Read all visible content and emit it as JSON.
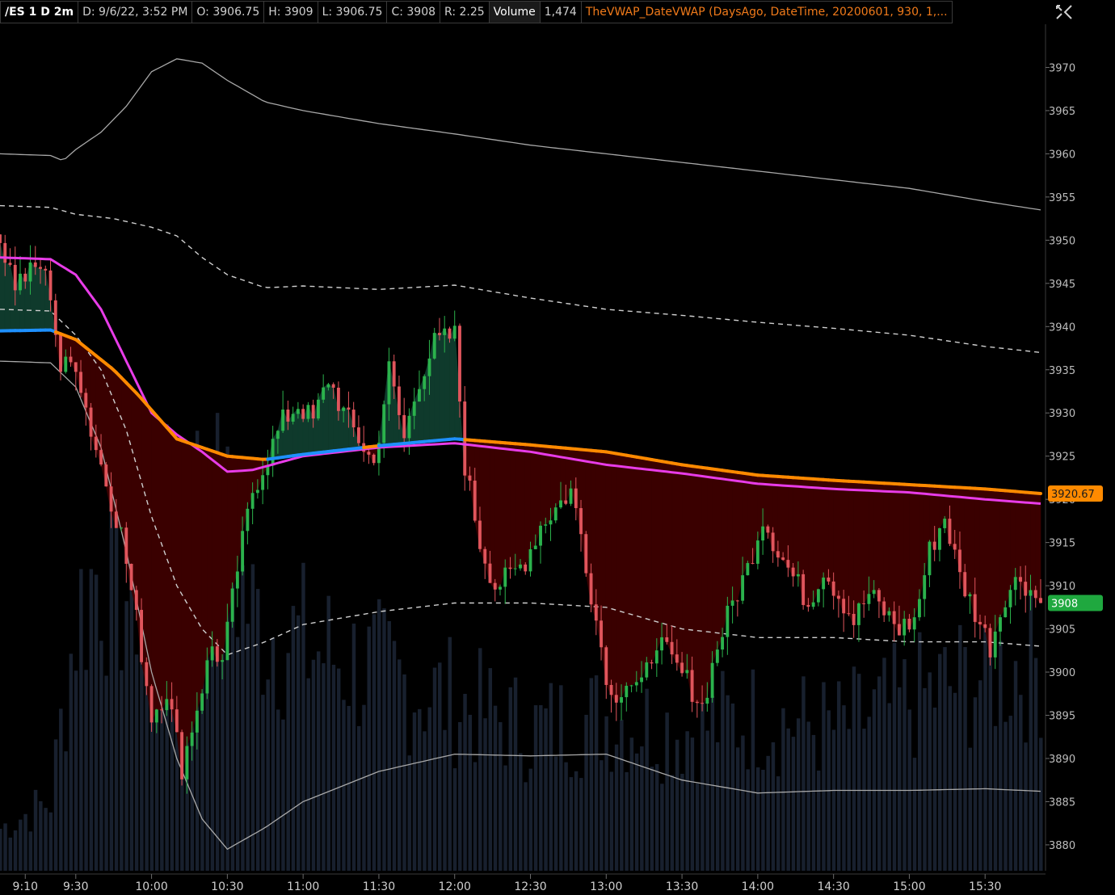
{
  "header": {
    "symbol": "/ES 1 D 2m",
    "date": "D: 9/6/22, 3:52 PM",
    "open": "O: 3906.75",
    "high": "H: 3909",
    "low": "L: 3906.75",
    "close": "C: 3908",
    "range": "R: 2.25",
    "volume_label": "Volume",
    "volume_value": "1,474",
    "study": "TheVWAP_DateVWAP (DaysAgo, DateTime, 20200601, 930, 1,..."
  },
  "icons": {
    "style": "style-settings-icon"
  },
  "colors": {
    "up": "#2bb24c",
    "down": "#e0555c",
    "vwap_above": "#1e90ff",
    "vwap_below": "#ff8a00",
    "anchored_vwap": "#e83ce8",
    "band": "#cfcfcf",
    "fill_red": "#3a0000",
    "fill_green": "#0f3a2c",
    "volume": "#18202e"
  },
  "chart_data": {
    "type": "candlestick",
    "ylim": [
      3877,
      3975
    ],
    "y_ticks": [
      3970,
      3965,
      3960,
      3955,
      3950,
      3945,
      3940,
      3935,
      3930,
      3925,
      3920,
      3915,
      3910,
      3905,
      3900,
      3895,
      3890,
      3885,
      3880
    ],
    "x_ticks": [
      "9:10",
      "9:30",
      "10:00",
      "10:30",
      "11:00",
      "11:30",
      "12:00",
      "12:30",
      "13:00",
      "13:30",
      "14:00",
      "14:30",
      "15:00",
      "15:30"
    ],
    "time_range": [
      "9:00",
      "15:52"
    ],
    "last_close": 3908,
    "last_close_label": "3908",
    "vwap_label": "3920.67",
    "price_path": [
      [
        "9:00",
        3950
      ],
      [
        "9:06",
        3945
      ],
      [
        "9:16",
        3947
      ],
      [
        "9:20",
        3944
      ],
      [
        "9:24",
        3935
      ],
      [
        "9:30",
        3936
      ],
      [
        "9:36",
        3928
      ],
      [
        "9:42",
        3922
      ],
      [
        "9:48",
        3916
      ],
      [
        "9:54",
        3906
      ],
      [
        "10:00",
        3895
      ],
      [
        "10:06",
        3898
      ],
      [
        "10:12",
        3889
      ],
      [
        "10:18",
        3896
      ],
      [
        "10:24",
        3903
      ],
      [
        "10:28",
        3901
      ],
      [
        "10:34",
        3912
      ],
      [
        "10:40",
        3921
      ],
      [
        "10:46",
        3925
      ],
      [
        "10:52",
        3929
      ],
      [
        "10:58",
        3931
      ],
      [
        "11:04",
        3929
      ],
      [
        "11:10",
        3934
      ],
      [
        "11:16",
        3930
      ],
      [
        "11:22",
        3927
      ],
      [
        "11:28",
        3924
      ],
      [
        "11:34",
        3935
      ],
      [
        "11:40",
        3927
      ],
      [
        "11:46",
        3934
      ],
      [
        "11:52",
        3938
      ],
      [
        "12:00",
        3939
      ],
      [
        "12:04",
        3924
      ],
      [
        "12:10",
        3915
      ],
      [
        "12:16",
        3910
      ],
      [
        "12:22",
        3911
      ],
      [
        "12:28",
        3913
      ],
      [
        "12:34",
        3917
      ],
      [
        "12:40",
        3919
      ],
      [
        "12:46",
        3921
      ],
      [
        "12:50",
        3916
      ],
      [
        "12:56",
        3906
      ],
      [
        "13:02",
        3897
      ],
      [
        "13:08",
        3899
      ],
      [
        "13:14",
        3898
      ],
      [
        "13:20",
        3904
      ],
      [
        "13:26",
        3901
      ],
      [
        "13:32",
        3899
      ],
      [
        "13:38",
        3896
      ],
      [
        "13:44",
        3903
      ],
      [
        "13:50",
        3908
      ],
      [
        "13:56",
        3912
      ],
      [
        "14:02",
        3918
      ],
      [
        "14:08",
        3914
      ],
      [
        "14:14",
        3911
      ],
      [
        "14:20",
        3908
      ],
      [
        "14:26",
        3912
      ],
      [
        "14:32",
        3909
      ],
      [
        "14:38",
        3906
      ],
      [
        "14:44",
        3909
      ],
      [
        "14:50",
        3907
      ],
      [
        "14:56",
        3905
      ],
      [
        "15:02",
        3906
      ],
      [
        "15:08",
        3914
      ],
      [
        "15:14",
        3918
      ],
      [
        "15:20",
        3911
      ],
      [
        "15:26",
        3907
      ],
      [
        "15:32",
        3903
      ],
      [
        "15:38",
        3909
      ],
      [
        "15:44",
        3911
      ],
      [
        "15:52",
        3908
      ]
    ],
    "vwap": [
      [
        "9:00",
        3939.5
      ],
      [
        "9:20",
        3939.6
      ],
      [
        "9:30",
        3938.5
      ],
      [
        "9:45",
        3935
      ],
      [
        "9:55",
        3932
      ],
      [
        "10:10",
        3927
      ],
      [
        "10:30",
        3925
      ],
      [
        "10:45",
        3924.6
      ],
      [
        "11:00",
        3925.2
      ],
      [
        "11:30",
        3926.2
      ],
      [
        "12:00",
        3927
      ],
      [
        "12:30",
        3926.3
      ],
      [
        "13:00",
        3925.5
      ],
      [
        "13:30",
        3924
      ],
      [
        "14:00",
        3922.8
      ],
      [
        "14:30",
        3922.2
      ],
      [
        "15:00",
        3921.7
      ],
      [
        "15:30",
        3921.2
      ],
      [
        "15:52",
        3920.67
      ]
    ],
    "anchored_vwap": [
      [
        "9:00",
        3948
      ],
      [
        "9:20",
        3947.8
      ],
      [
        "9:30",
        3946
      ],
      [
        "9:40",
        3942
      ],
      [
        "9:50",
        3936
      ],
      [
        "10:00",
        3930
      ],
      [
        "10:10",
        3927.5
      ],
      [
        "10:20",
        3925.5
      ],
      [
        "10:30",
        3923.2
      ],
      [
        "10:40",
        3923.4
      ],
      [
        "11:00",
        3925
      ],
      [
        "11:30",
        3926
      ],
      [
        "12:00",
        3926.5
      ],
      [
        "12:30",
        3925.5
      ],
      [
        "13:00",
        3924
      ],
      [
        "13:30",
        3923
      ],
      [
        "14:00",
        3921.8
      ],
      [
        "14:30",
        3921.2
      ],
      [
        "15:00",
        3920.8
      ],
      [
        "15:30",
        3920
      ],
      [
        "15:52",
        3919.5
      ]
    ],
    "upper_band_2": [
      [
        "9:00",
        3960
      ],
      [
        "9:20",
        3959.8
      ],
      [
        "9:25",
        3959.2
      ],
      [
        "9:30",
        3960.5
      ],
      [
        "9:40",
        3962.5
      ],
      [
        "9:50",
        3965.5
      ],
      [
        "10:00",
        3969.5
      ],
      [
        "10:10",
        3971
      ],
      [
        "10:20",
        3970.5
      ],
      [
        "10:30",
        3968.5
      ],
      [
        "10:45",
        3966
      ],
      [
        "11:00",
        3965
      ],
      [
        "11:30",
        3963.5
      ],
      [
        "12:00",
        3962.3
      ],
      [
        "12:30",
        3961
      ],
      [
        "13:00",
        3960
      ],
      [
        "13:30",
        3959
      ],
      [
        "14:00",
        3958
      ],
      [
        "14:30",
        3957
      ],
      [
        "15:00",
        3956
      ],
      [
        "15:30",
        3954.5
      ],
      [
        "15:52",
        3953.5
      ]
    ],
    "upper_band_1": [
      [
        "9:00",
        3954
      ],
      [
        "9:20",
        3953.8
      ],
      [
        "9:30",
        3953
      ],
      [
        "9:45",
        3952.5
      ],
      [
        "10:00",
        3951.5
      ],
      [
        "10:10",
        3950.5
      ],
      [
        "10:20",
        3948
      ],
      [
        "10:30",
        3946
      ],
      [
        "10:45",
        3944.5
      ],
      [
        "11:00",
        3944.7
      ],
      [
        "11:30",
        3944.3
      ],
      [
        "12:00",
        3944.8
      ],
      [
        "12:30",
        3943.3
      ],
      [
        "13:00",
        3942
      ],
      [
        "13:30",
        3941.3
      ],
      [
        "14:00",
        3940.5
      ],
      [
        "14:30",
        3939.8
      ],
      [
        "15:00",
        3939
      ],
      [
        "15:30",
        3937.7
      ],
      [
        "15:52",
        3937
      ]
    ],
    "lower_band_1": [
      [
        "9:00",
        3942
      ],
      [
        "9:20",
        3941.8
      ],
      [
        "9:30",
        3939
      ],
      [
        "9:40",
        3935
      ],
      [
        "9:50",
        3928
      ],
      [
        "10:00",
        3918
      ],
      [
        "10:10",
        3910
      ],
      [
        "10:20",
        3905
      ],
      [
        "10:30",
        3902
      ],
      [
        "10:45",
        3903.5
      ],
      [
        "11:00",
        3905.5
      ],
      [
        "11:30",
        3907
      ],
      [
        "12:00",
        3908
      ],
      [
        "12:30",
        3908
      ],
      [
        "13:00",
        3907.5
      ],
      [
        "13:30",
        3905
      ],
      [
        "14:00",
        3904
      ],
      [
        "14:30",
        3904
      ],
      [
        "15:00",
        3903.5
      ],
      [
        "15:30",
        3903.5
      ],
      [
        "15:52",
        3903
      ]
    ],
    "lower_band_2": [
      [
        "9:00",
        3936
      ],
      [
        "9:20",
        3935.8
      ],
      [
        "9:30",
        3933
      ],
      [
        "9:40",
        3926
      ],
      [
        "9:50",
        3914
      ],
      [
        "10:00",
        3900
      ],
      [
        "10:10",
        3890
      ],
      [
        "10:20",
        3883
      ],
      [
        "10:30",
        3879.5
      ],
      [
        "10:45",
        3882
      ],
      [
        "11:00",
        3885
      ],
      [
        "11:30",
        3888.5
      ],
      [
        "12:00",
        3890.5
      ],
      [
        "12:30",
        3890.3
      ],
      [
        "13:00",
        3890.5
      ],
      [
        "13:15",
        3889
      ],
      [
        "13:30",
        3887.5
      ],
      [
        "14:00",
        3886
      ],
      [
        "14:30",
        3886.3
      ],
      [
        "15:00",
        3886.3
      ],
      [
        "15:30",
        3886.5
      ],
      [
        "15:52",
        3886.2
      ]
    ],
    "volume_profile": [
      [
        "9:00",
        3
      ],
      [
        "9:20",
        5
      ],
      [
        "9:30",
        18
      ],
      [
        "9:40",
        22
      ],
      [
        "9:50",
        20
      ],
      [
        "10:00",
        21
      ],
      [
        "10:10",
        24
      ],
      [
        "10:20",
        26
      ],
      [
        "10:30",
        23
      ],
      [
        "10:40",
        18
      ],
      [
        "11:00",
        16
      ],
      [
        "11:30",
        14
      ],
      [
        "12:00",
        12
      ],
      [
        "12:30",
        10
      ],
      [
        "13:00",
        11
      ],
      [
        "13:30",
        10
      ],
      [
        "14:00",
        11
      ],
      [
        "14:30",
        10
      ],
      [
        "15:00",
        12
      ],
      [
        "15:30",
        14
      ],
      [
        "15:52",
        15
      ]
    ],
    "volume_max": 30
  }
}
